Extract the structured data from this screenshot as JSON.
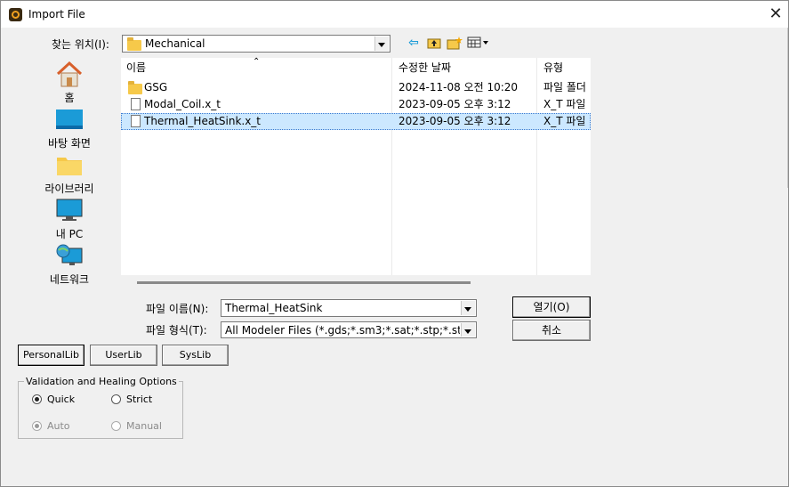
{
  "window": {
    "title": "Import File",
    "close_glyph": "✕"
  },
  "look_in": {
    "label": "찾는 위치(I):",
    "value": "Mechanical"
  },
  "toolbar": {
    "back_icon": "back-arrow-icon",
    "up_icon": "up-folder-icon",
    "new_folder_icon": "new-folder-icon",
    "view_menu_icon": "view-menu-icon"
  },
  "places": [
    {
      "label": "홈",
      "icon": "home-icon"
    },
    {
      "label": "바탕 화면",
      "icon": "desktop-icon"
    },
    {
      "label": "라이브러리",
      "icon": "library-icon"
    },
    {
      "label": "내 PC",
      "icon": "pc-icon"
    },
    {
      "label": "네트워크",
      "icon": "network-icon"
    }
  ],
  "file_list": {
    "columns": [
      "이름",
      "수정한 날짜",
      "유형"
    ],
    "rows": [
      {
        "name": "GSG",
        "date": "2024-11-08 오전 10:20",
        "type": "파일 폴더",
        "icon": "folder-icon",
        "selected": false
      },
      {
        "name": "Modal_Coil.x_t",
        "date": "2023-09-05 오후 3:12",
        "type": "X_T 파일",
        "icon": "file-icon",
        "selected": false
      },
      {
        "name": "Thermal_HeatSink.x_t",
        "date": "2023-09-05 오후 3:12",
        "type": "X_T 파일",
        "icon": "file-icon",
        "selected": true
      }
    ]
  },
  "file_name": {
    "label": "파일 이름(N):",
    "value": "Thermal_HeatSink"
  },
  "file_type": {
    "label": "파일 형식(T):",
    "value": "All Modeler Files (*.gds;*.sm3;*.sat;*.stp;*.step"
  },
  "buttons": {
    "open": "열기(O)",
    "cancel": "취소",
    "personal_lib": "PersonalLib",
    "user_lib": "UserLib",
    "sys_lib": "SysLib"
  },
  "validation": {
    "title": "Validation and Healing Options",
    "quick": "Quick",
    "strict": "Strict",
    "auto": "Auto",
    "manual": "Manual",
    "selected_mode": "Quick",
    "selected_sub": "Auto"
  },
  "colors": {
    "selection": "#cce8ff",
    "folder": "#f6c94a",
    "toolbar_arrow": "#1b9bd7"
  }
}
